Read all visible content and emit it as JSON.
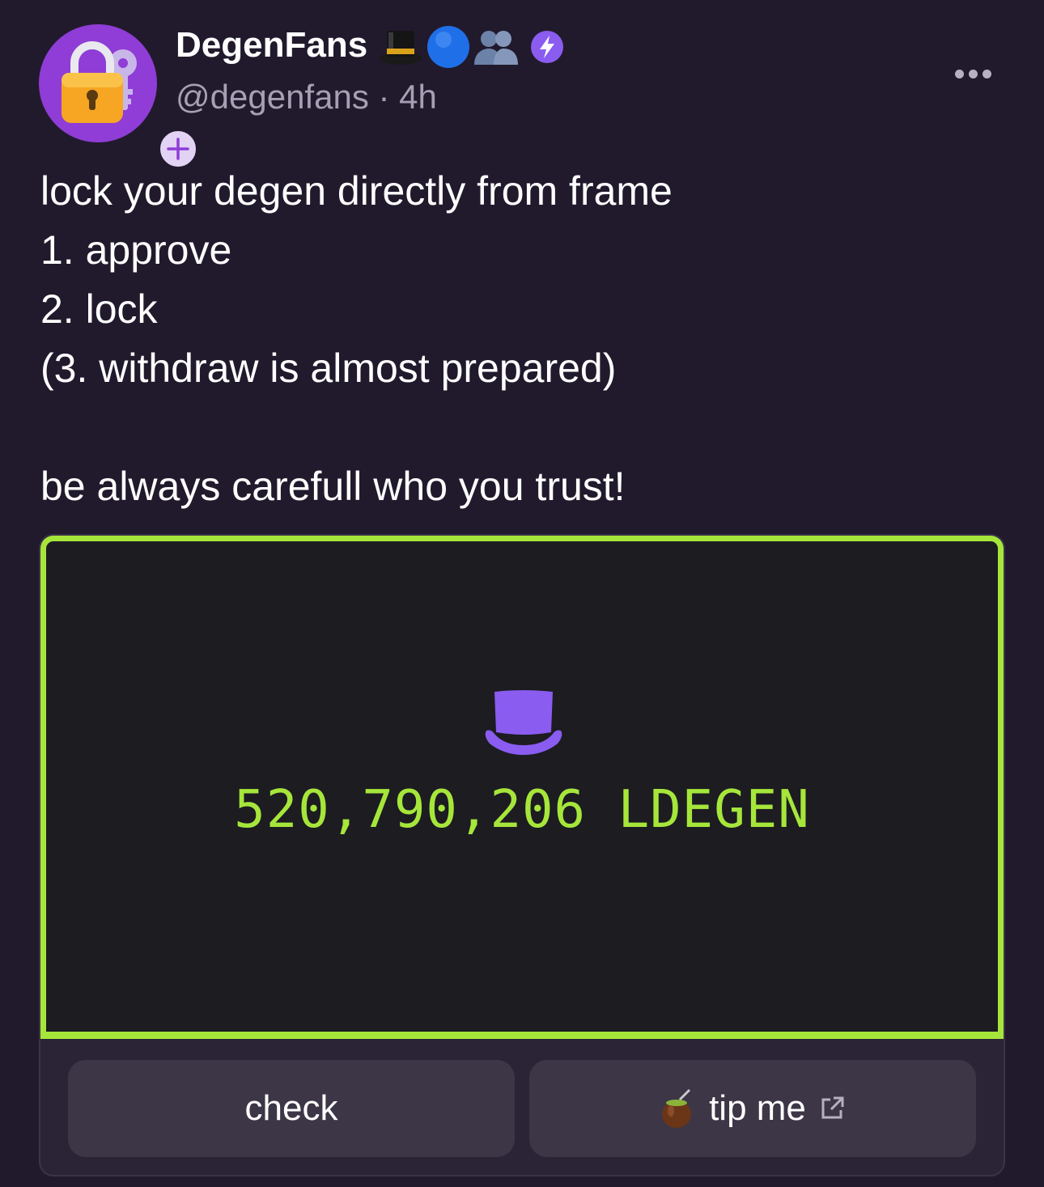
{
  "author": {
    "display_name": "DegenFans",
    "handle": "@degenfans",
    "separator": "·",
    "time_ago": "4h",
    "badges": [
      "top-hat-icon",
      "blue-circle-icon",
      "people-icon",
      "power-badge-icon"
    ]
  },
  "post": {
    "lines": [
      "lock your degen directly from frame",
      "1. approve",
      "2. lock",
      "(3. withdraw is almost prepared)",
      "",
      "be always carefull who you trust!"
    ]
  },
  "frame": {
    "amount_text": "520,790,206 LDEGEN",
    "accent_color": "#a6e63b",
    "hat_color": "#8a5cf0",
    "buttons": [
      {
        "label": "check"
      },
      {
        "label": "tip me",
        "leading_icon": "mate-gourd-icon",
        "trailing_icon": "external-link-icon"
      }
    ]
  },
  "colors": {
    "background": "#211a2c",
    "muted_text": "#a79fb3",
    "button_bg": "#3c3647"
  }
}
